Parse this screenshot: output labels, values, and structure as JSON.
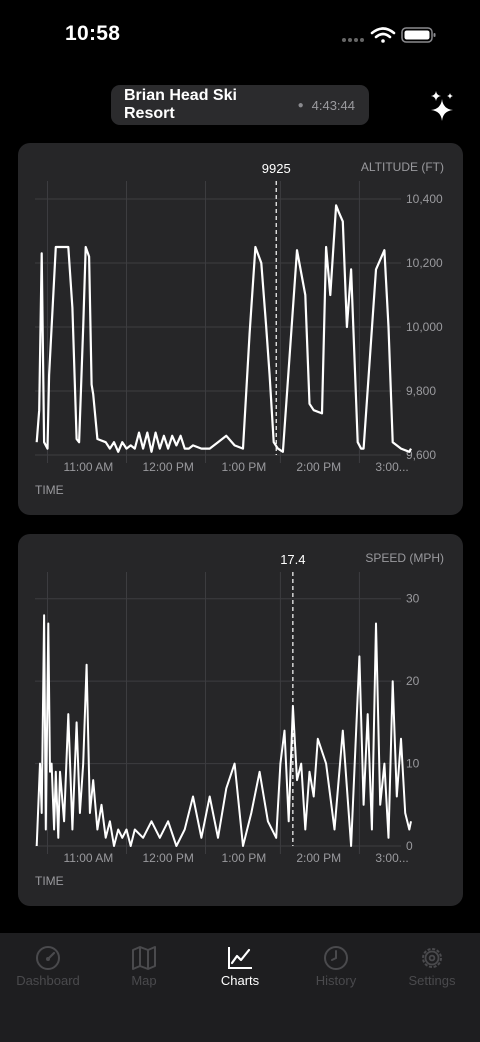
{
  "status_bar": {
    "time": "10:58"
  },
  "header": {
    "title": "Brian Head Ski Resort",
    "duration": "4:43:44"
  },
  "altitude_chart": {
    "axis_title": "ALTITUDE (FT)",
    "x_title": "TIME",
    "cursor_value": "9925",
    "y_ticks": [
      "10,400",
      "10,200",
      "10,000",
      "9,800",
      "9,600"
    ],
    "x_ticks": [
      "11:00 AM",
      "12:00 PM",
      "1:00 PM",
      "2:00 PM",
      "3:00..."
    ]
  },
  "speed_chart": {
    "axis_title": "SPEED (MPH)",
    "x_title": "TIME",
    "cursor_value": "17.4",
    "y_ticks": [
      "30",
      "20",
      "10",
      "0"
    ],
    "x_ticks": [
      "11:00 AM",
      "12:00 PM",
      "1:00 PM",
      "2:00 PM",
      "3:00..."
    ]
  },
  "tabs": [
    {
      "label": "Dashboard",
      "icon": "speedometer-icon"
    },
    {
      "label": "Map",
      "icon": "map-icon"
    },
    {
      "label": "Charts",
      "icon": "chart-line-icon",
      "active": true
    },
    {
      "label": "History",
      "icon": "clock-icon"
    },
    {
      "label": "Settings",
      "icon": "gear-icon"
    }
  ],
  "chart_data": [
    {
      "type": "line",
      "title": "",
      "xlabel": "TIME",
      "ylabel": "ALTITUDE (FT)",
      "x_ticks": [
        "11:00 AM",
        "12:00 PM",
        "1:00 PM",
        "2:00 PM",
        "3:00..."
      ],
      "ylim": [
        9600,
        10450
      ],
      "xlim": [
        10.8,
        15.2
      ],
      "cursor": {
        "x": 13.7,
        "label": "9925"
      },
      "series": [
        {
          "x": [
            10.82,
            10.85,
            10.88,
            10.91,
            10.95,
            10.97,
            11.05,
            11.12,
            11.2,
            11.25,
            11.3,
            11.33,
            11.38,
            11.41,
            11.45,
            11.48,
            11.5,
            11.55,
            11.65,
            11.7,
            11.75,
            11.8,
            11.85,
            11.9,
            11.95,
            12,
            12.05,
            12.1,
            12.15,
            12.2,
            12.25,
            12.3,
            12.35,
            12.4,
            12.45,
            12.5,
            12.55,
            12.6,
            12.65,
            12.7,
            12.8,
            12.9,
            13,
            13.1,
            13.2,
            13.3,
            13.38,
            13.45,
            13.52,
            13.58,
            13.62,
            13.67,
            13.72,
            13.78,
            13.95,
            14.05,
            14.1,
            14.15,
            14.25,
            14.3,
            14.35,
            14.42,
            14.45,
            14.5,
            14.55,
            14.6,
            14.68,
            14.72,
            14.75,
            14.9,
            15.0,
            15.05,
            15.1,
            15.15,
            15.2,
            15.3,
            15.32
          ],
          "y": [
            9640,
            9740,
            10230,
            9640,
            9620,
            9850,
            10250,
            10250,
            10250,
            10060,
            9650,
            9640,
            10000,
            10250,
            10220,
            9820,
            9790,
            9650,
            9640,
            9620,
            9640,
            9610,
            9640,
            9620,
            9630,
            9620,
            9670,
            9620,
            9670,
            9610,
            9670,
            9620,
            9660,
            9620,
            9660,
            9630,
            9660,
            9620,
            9620,
            9630,
            9620,
            9620,
            9640,
            9660,
            9630,
            9620,
            9980,
            10250,
            10200,
            10000,
            9850,
            9640,
            9620,
            9610,
            10240,
            10100,
            9760,
            9740,
            9730,
            10250,
            10100,
            10380,
            10360,
            10330,
            10000,
            10180,
            9640,
            9620,
            9620,
            10180,
            10240,
            10000,
            9640,
            9630,
            9620,
            9610,
            9620
          ]
        }
      ]
    },
    {
      "type": "line",
      "title": "",
      "xlabel": "TIME",
      "ylabel": "SPEED (MPH)",
      "x_ticks": [
        "11:00 AM",
        "12:00 PM",
        "1:00 PM",
        "2:00 PM",
        "3:00..."
      ],
      "ylim": [
        0,
        33
      ],
      "xlim": [
        10.8,
        15.2
      ],
      "cursor": {
        "x": 13.9,
        "label": "17.4"
      },
      "series": [
        {
          "x": [
            10.82,
            10.86,
            10.88,
            10.91,
            10.93,
            10.96,
            10.98,
            11.0,
            11.03,
            11.05,
            11.08,
            11.1,
            11.15,
            11.2,
            11.25,
            11.3,
            11.34,
            11.38,
            11.42,
            11.46,
            11.5,
            11.55,
            11.6,
            11.65,
            11.7,
            11.75,
            11.8,
            11.85,
            11.9,
            11.95,
            12.0,
            12.1,
            12.2,
            12.3,
            12.4,
            12.5,
            12.6,
            12.7,
            12.8,
            12.9,
            13.0,
            13.1,
            13.2,
            13.3,
            13.4,
            13.5,
            13.6,
            13.7,
            13.75,
            13.8,
            13.85,
            13.9,
            13.95,
            14.0,
            14.05,
            14.1,
            14.15,
            14.2,
            14.3,
            14.4,
            14.5,
            14.6,
            14.7,
            14.75,
            14.8,
            14.85,
            14.9,
            14.95,
            15.0,
            15.05,
            15.1,
            15.15,
            15.2,
            15.25,
            15.3,
            15.32
          ],
          "y": [
            0,
            10,
            4,
            28,
            2,
            27,
            9,
            10,
            2,
            9,
            1,
            9,
            3,
            16,
            2,
            15,
            4,
            10,
            22,
            4,
            8,
            2,
            5,
            1,
            3,
            0,
            2,
            1,
            2,
            0,
            2,
            1,
            3,
            1,
            3,
            0,
            2,
            6,
            1,
            6,
            1,
            7,
            10,
            0,
            4,
            9,
            3,
            1,
            10,
            14,
            3,
            17,
            8,
            10,
            2,
            9,
            6,
            13,
            10,
            2,
            14,
            0,
            23,
            5,
            16,
            2,
            27,
            5,
            10,
            1,
            20,
            6,
            13,
            4,
            2,
            3
          ]
        }
      ]
    }
  ]
}
